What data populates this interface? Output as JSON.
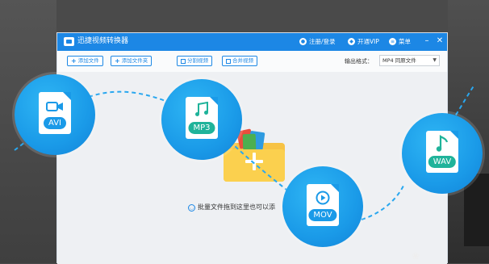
{
  "window": {
    "title": "迅捷视频转换器",
    "links": {
      "register": "注册/登录",
      "vip": "开通VIP",
      "menu": "菜单"
    }
  },
  "toolbar": {
    "add_file": "添加文件",
    "add_folder": "添加文件夹",
    "split_video": "分割视频",
    "merge_video": "合并视频",
    "output_format_label": "输出格式：",
    "output_format_value": "MP4  同原文件"
  },
  "main": {
    "drop_hint": "批量文件拖到这里也可以添"
  },
  "formats": [
    {
      "label": "AVI",
      "icon": "video-camera-icon",
      "color": "#1a9ae8"
    },
    {
      "label": "MP3",
      "icon": "music-notes-icon",
      "color": "#1fb39a"
    },
    {
      "label": "MOV",
      "icon": "play-icon",
      "color": "#1a9ae8"
    },
    {
      "label": "WAV",
      "icon": "music-note-icon",
      "color": "#1fb39a"
    }
  ],
  "colors": {
    "accent": "#1c87e5",
    "folder": "#f7c344",
    "teal": "#1fb39a"
  }
}
